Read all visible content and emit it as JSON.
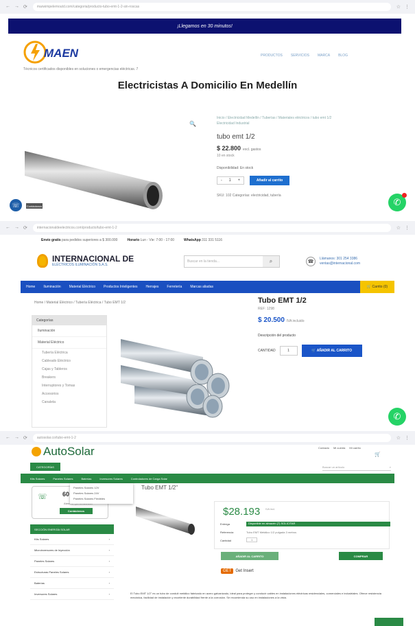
{
  "panel1": {
    "url": "marwimpelemoutd.com/categoria/producto-tubo-emt-1-2-sin-roscas",
    "banner": "¡Llegamos en 30 minutos!",
    "logo_text": "MAEN",
    "menu": [
      "PRODUCTOS",
      "SERVICIOS",
      "MARCA",
      "BLOG"
    ],
    "tagline": "Técnicos certificados disponibles en soluciones o emergencias eléctricas. 7",
    "heading": "Electricistas A Domicilio En Medellín",
    "breadcrumb": "Inicio / Electricidad Medellín / Tuberías / Materiales eléctricos / tubo emt 1/2",
    "breadcrumb2": "Electricidad Industrial",
    "product_title": "tubo emt 1/2",
    "price": "$ 22.800",
    "price_note": "excl. gastos",
    "units": "10 en stock",
    "availability": "Disponibilidad: En stock",
    "qty": "1",
    "cart_button": "Añadir al carrito",
    "meta": "SKU: 102   Categorías: electricidad, tubería",
    "contact_label": "Contáctanos",
    "phone_icon": "phone-icon",
    "whatsapp_icon": "whatsapp-icon"
  },
  "panel2": {
    "url": "internacionaldeelectricos.com/producto/tubo-emt-1-2",
    "topinfo": [
      {
        "bold": "Envío gratis",
        "text": "para pedidos superiores a $ 300.000"
      },
      {
        "bold": "Horario",
        "text": "Lun - Vie: 7:00 - 17:00"
      },
      {
        "bold": "WhatsApp",
        "text": "311 331 5116"
      }
    ],
    "brand_name": "INTERNACIONAL DE",
    "brand_sub": "ELÉCTRICOS ILUMINACIÓN S.A.S.",
    "search_placeholder": "Buscar en la tienda...",
    "contact_title": "Llámanos: 301 254 3386",
    "contact_sub": "ventas@internacional.com",
    "nav": [
      "Home",
      "Iluminación",
      "Material Eléctrico",
      "Productos Inteligentes",
      "Herrajes",
      "Ferretería",
      "Marcas aliadas"
    ],
    "cart_label": "Carrito (0)",
    "breadcrumb": "Home / Material Eléctrico / Tubería Eléctrica / Tubo EMT 1/2",
    "sidebar_title": "Categorías",
    "sidebar_items": [
      "Iluminación",
      "Material Eléctrico"
    ],
    "sidebar_sub": [
      "Tubería Eléctrica",
      "Cableado Eléctrico",
      "Cajas y Tableros",
      "Breakers",
      "Interruptores y Tomas",
      "Accesorios",
      "Canaleta"
    ],
    "product_title": "Tubo EMT 1/2",
    "ref": "REF: 1298",
    "price": "$ 20.500",
    "price_note": "IVA incluido",
    "desc_label": "Descripción del producto",
    "qty_label": "CANTIDAD",
    "qty": "1",
    "add_button": "AÑADIR AL CARRITO"
  },
  "panel3": {
    "url": "autosolar.co/tubo-emt-1-2",
    "logo": "AutoSolar",
    "toplinks": [
      "Contacto",
      "Mi cuenta",
      "Mi carrito"
    ],
    "cat_button": "CATEGORÍAS",
    "search_placeholder": "Buscar un artículo",
    "green_nav": [
      "Kits Solares",
      "Paneles Solares",
      "Baterías",
      "Inversores Solares",
      "Controladores de Carga Solar"
    ],
    "dropdown": [
      "Paneles Solares 12V",
      "Paneles Solares 24V",
      "Paneles Solares Flexibles"
    ],
    "call_number": "60",
    "call_small": "Atención personalizada",
    "call_button": "Contáctenos",
    "sidebar_title": "SECCIÓN ENERGÍA SOLAR",
    "sidebar_items": [
      "Kits Solares",
      "Microinversores de Inyección",
      "Paneles Solares",
      "Estructuras Paneles Solares",
      "Baterías",
      "Inversores Solares"
    ],
    "product_title": "Tubo EMT 1/2\"",
    "price": "$28.193",
    "price_note": "IVA incl.",
    "stock_label": "Entrega",
    "stock_value": "Disponible en almacén (7) SOLICITAR",
    "ref_label": "Referencia",
    "ref_value": "Tubo EMT Metálico 1/2 pulgada 3 metros",
    "qty_label": "Cantidad",
    "qty": "1",
    "add_button": "AÑADIR AL CARRITO",
    "buy_button": "COMPRAR",
    "badge_prefix": "GET",
    "badge_text": "Get Insert",
    "paragraph": "El Tubo EMT 1/2\" es un tubo de conduit metálico fabricado en acero galvanizado, ideal para proteger y conducir cables en instalaciones eléctricas residenciales, comerciales e industriales. Ofrece resistencia mecánica, facilidad de instalación y excelente durabilidad frente a la corrosión. Se recomienda su uso en instalaciones a la vista."
  }
}
